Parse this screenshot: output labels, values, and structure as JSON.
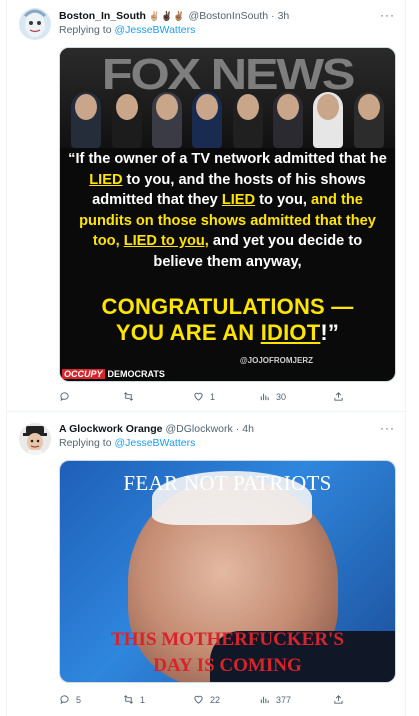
{
  "tweets": [
    {
      "name": "Boston_In_South",
      "emoji": "✌🏼✌🏿✌🏽",
      "handle": "@BostonInSouth",
      "time": "3h",
      "more": "···",
      "replying_label": "Replying to",
      "replying_to": "@JesseBWatters",
      "media": {
        "logo": "FOX NEWS",
        "text_parts": [
          "“If the owner of a TV network admitted that he ",
          "LIED",
          " to you, and the hosts of his shows admitted that they ",
          "LIED",
          " to you, ",
          "and the pundits on those shows admitted that they too, ",
          "LIED to you,",
          " and yet you decide to believe them anyway,"
        ],
        "big_line_1": "CONGRATULATIONS —",
        "big_line_2_a": "YOU ARE AN ",
        "big_line_2_b": "IDIOT",
        "big_line_2_c": "!”",
        "credit": "@JOJOFROMJERZ",
        "brand_a": "OCCUPY",
        "brand_b": "DEMOCRATS"
      },
      "actions": {
        "replies": "",
        "retweets": "",
        "likes": "1",
        "views": "30"
      }
    },
    {
      "name": "A Glockwork Orange",
      "handle": "@DGlockwork",
      "time": "4h",
      "more": "···",
      "replying_label": "Replying to",
      "replying_to": "@JesseBWatters",
      "media": {
        "top_text": "FEAR NOT PATRIOTS",
        "bottom_line_1": "THIS MOTHERFUCKER'S",
        "bottom_line_2": "DAY IS COMING"
      },
      "actions": {
        "replies": "5",
        "retweets": "1",
        "likes": "22",
        "views": "377"
      }
    }
  ],
  "colors": {
    "accent": "#1d9bf0",
    "muted": "#536471",
    "meme_yellow": "#ffe400",
    "meme_red": "#d9232b"
  }
}
